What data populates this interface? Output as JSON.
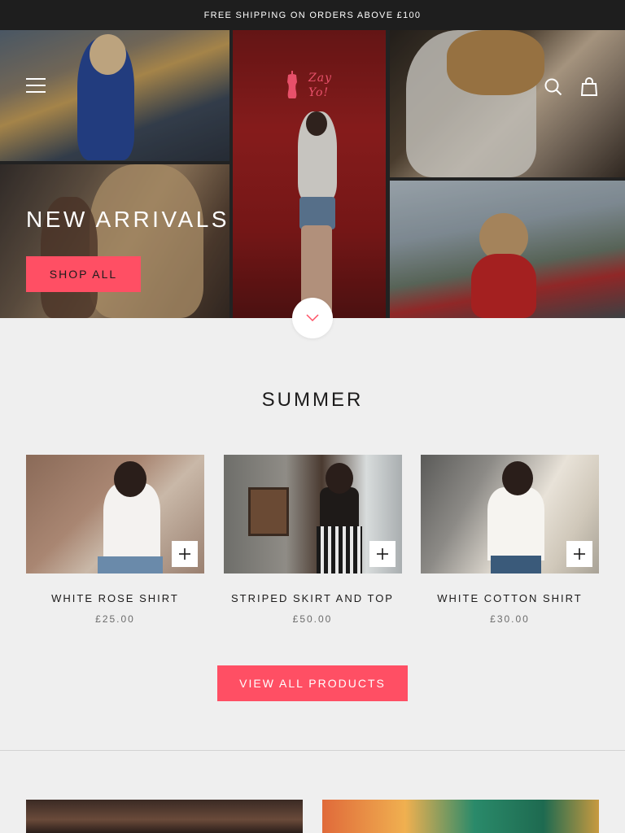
{
  "announcement": {
    "text": "FREE SHIPPING ON ORDERS ABOVE £100"
  },
  "header": {
    "logo_line1": "Zay",
    "logo_line2": "Yo!",
    "brand_color": "#e8506a"
  },
  "hero": {
    "title": "NEW ARRIVALS",
    "cta_label": "SHOP ALL"
  },
  "collection": {
    "title": "SUMMER",
    "products": [
      {
        "name": "WHITE ROSE SHIRT",
        "price": "£25.00"
      },
      {
        "name": "STRIPED SKIRT AND TOP",
        "price": "£50.00"
      },
      {
        "name": "WHITE COTTON SHIRT",
        "price": "£30.00"
      }
    ],
    "view_all_label": "VIEW ALL PRODUCTS"
  },
  "colors": {
    "accent": "#ff4f64",
    "announcement_bg": "#1e1e1e",
    "page_bg": "#efefef"
  },
  "icons": {
    "menu": "menu-icon",
    "search": "search-icon",
    "cart": "bag-icon",
    "scroll": "chevron-down-icon",
    "add": "plus-icon"
  }
}
